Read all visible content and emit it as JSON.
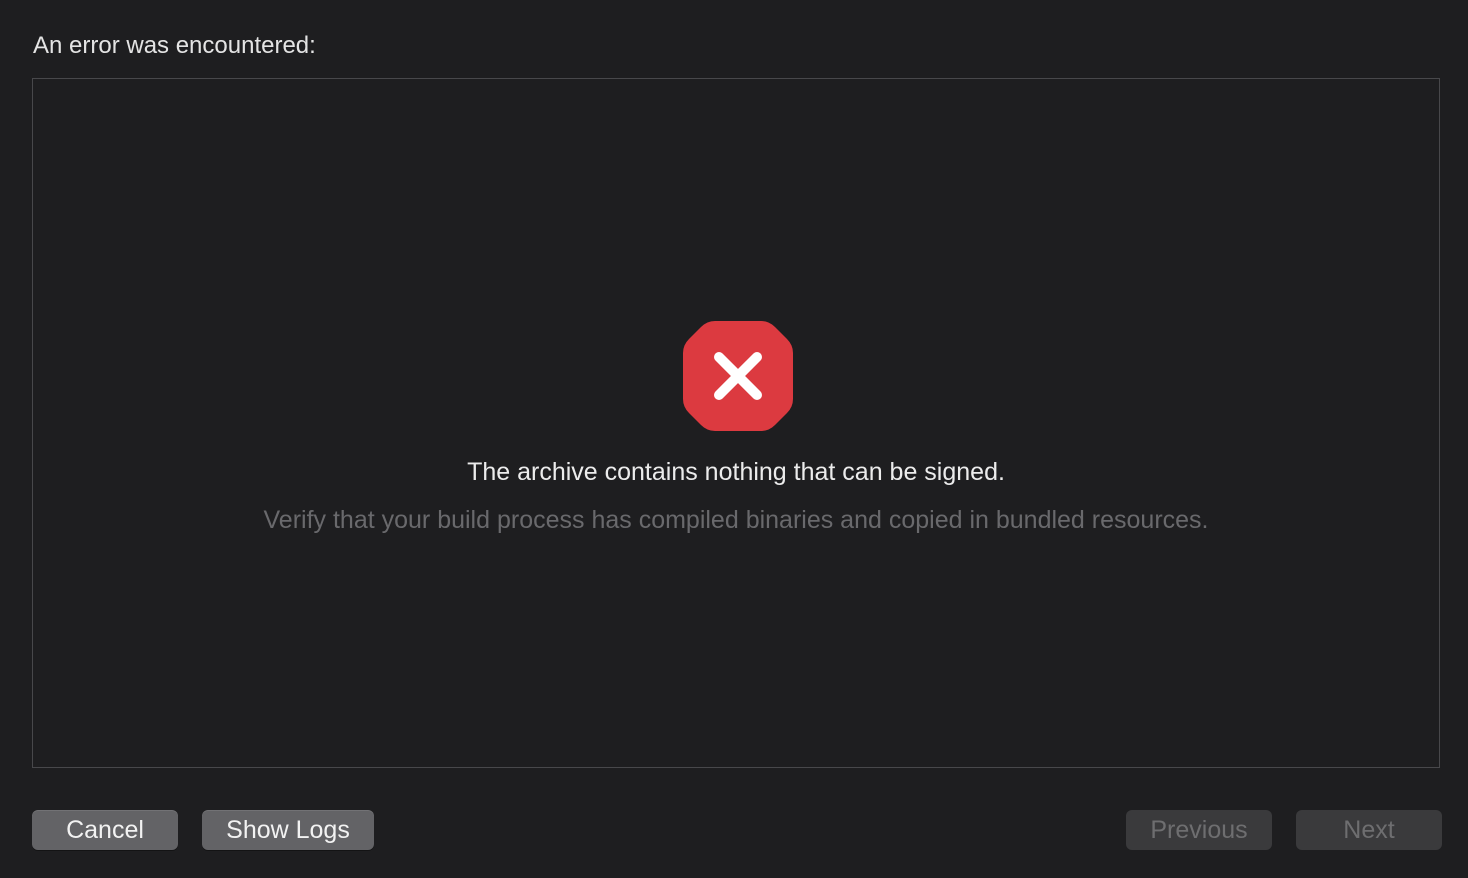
{
  "dialog": {
    "heading": "An error was encountered:"
  },
  "error": {
    "icon": "error-stop-icon",
    "icon_color": "#dc3a40",
    "title": "The archive contains nothing that can be signed.",
    "detail": "Verify that your build process has compiled binaries and copied in bundled resources."
  },
  "buttons": {
    "cancel": "Cancel",
    "show_logs": "Show Logs",
    "previous": "Previous",
    "next": "Next"
  }
}
